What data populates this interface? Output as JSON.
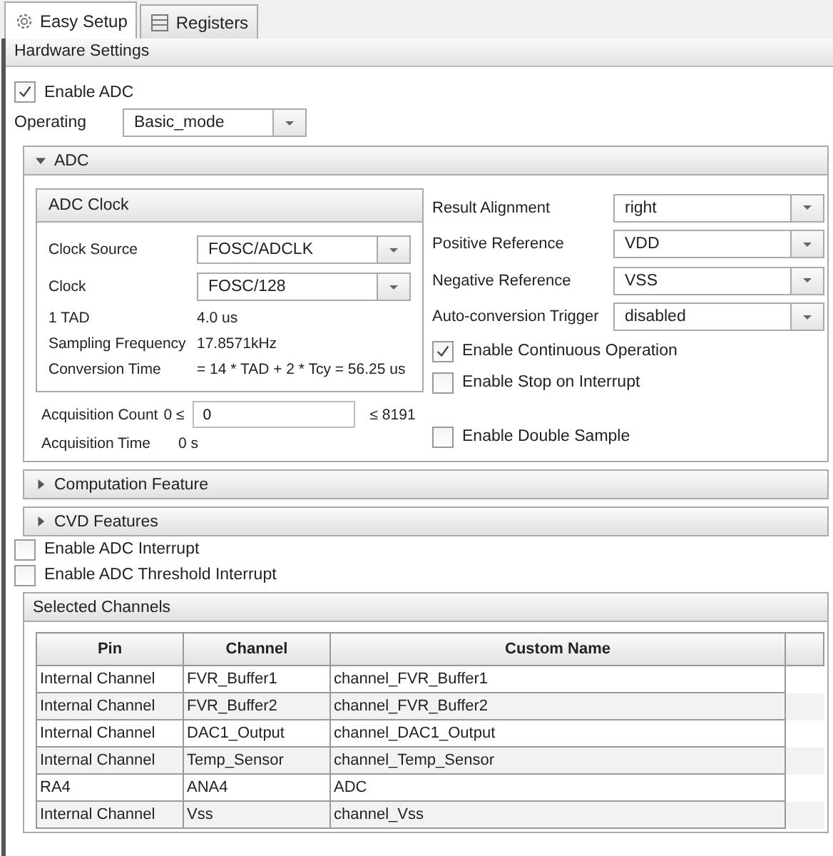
{
  "tabs": [
    {
      "label": "Easy Setup",
      "selected": true
    },
    {
      "label": "Registers",
      "selected": false
    }
  ],
  "section_title": "Hardware Settings",
  "enable_adc": {
    "label": "Enable ADC",
    "checked": true
  },
  "operating": {
    "label": "Operating",
    "value": "Basic_mode"
  },
  "adc_panel": {
    "title": "ADC",
    "expanded": true,
    "clock": {
      "title": "ADC Clock",
      "fields": [
        {
          "label": "Clock Source",
          "value": "FOSC/ADCLK"
        },
        {
          "label": "Clock",
          "value": "FOSC/128"
        }
      ],
      "info": [
        {
          "label": "1 TAD",
          "value": "4.0 us"
        },
        {
          "label": "Sampling Frequency",
          "value": "17.8571kHz"
        },
        {
          "label": "Conversion Time",
          "value": "= 14 * TAD + 2 * Tcy =  56.25 us"
        }
      ]
    },
    "acquisition_count": {
      "label": "Acquisition Count",
      "lower": "0 ≤",
      "value": "0",
      "upper": "≤ 8191"
    },
    "acquisition_time": {
      "label": "Acquisition Time",
      "value": "0 s"
    },
    "settings": [
      {
        "label": "Result Alignment",
        "value": "right"
      },
      {
        "label": "Positive Reference",
        "value": "VDD"
      },
      {
        "label": "Negative Reference",
        "value": "VSS"
      },
      {
        "label": "Auto-conversion Trigger",
        "value": "disabled"
      }
    ],
    "options": [
      {
        "label": "Enable Continuous Operation",
        "checked": true
      },
      {
        "label": "Enable Stop on Interrupt",
        "checked": false
      },
      {
        "label": "Enable Double Sample",
        "checked": false
      }
    ]
  },
  "collapsed_sections": [
    {
      "title": "Computation Feature",
      "expanded": false
    },
    {
      "title": "CVD Features",
      "expanded": false
    }
  ],
  "interrupts": [
    {
      "label": "Enable ADC Interrupt",
      "checked": false
    },
    {
      "label": "Enable ADC Threshold Interrupt",
      "checked": false
    }
  ],
  "channels": {
    "title": "Selected Channels",
    "columns": [
      "Pin",
      "Channel",
      "Custom Name"
    ],
    "rows": [
      [
        "Internal Channel",
        "FVR_Buffer1",
        "channel_FVR_Buffer1"
      ],
      [
        "Internal Channel",
        "FVR_Buffer2",
        "channel_FVR_Buffer2"
      ],
      [
        "Internal Channel",
        "DAC1_Output",
        "channel_DAC1_Output"
      ],
      [
        "Internal Channel",
        "Temp_Sensor",
        "channel_Temp_Sensor"
      ],
      [
        "RA4",
        "ANA4",
        "ADC"
      ],
      [
        "Internal Channel",
        "Vss",
        "channel_Vss"
      ]
    ]
  }
}
